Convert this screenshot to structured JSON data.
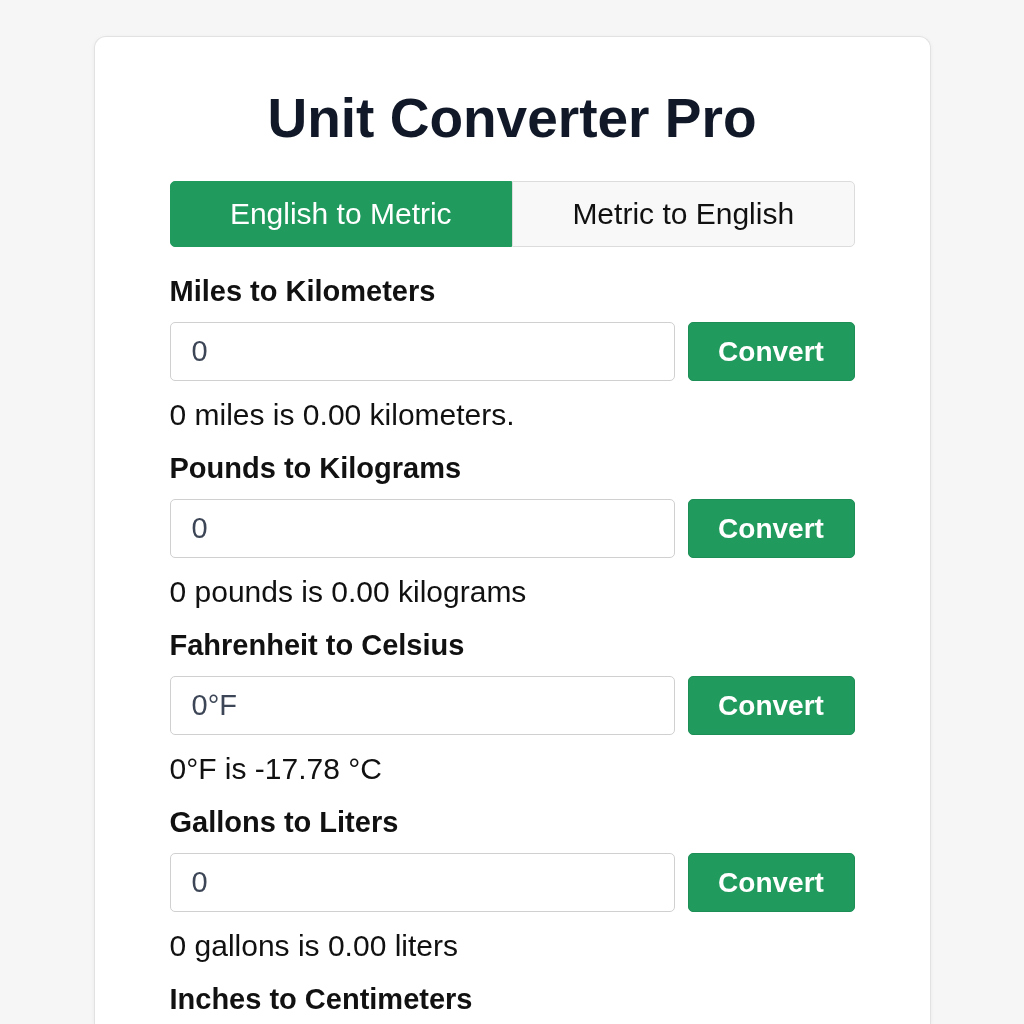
{
  "app": {
    "title": "Unit Converter Pro"
  },
  "tabs": [
    {
      "label": "English to Metric",
      "selected": true
    },
    {
      "label": "Metric to English",
      "selected": false
    }
  ],
  "converters": [
    {
      "label": "Miles to Kilometers",
      "value": "0",
      "button": "Convert",
      "result": "0 miles is 0.00 kilometers."
    },
    {
      "label": "Pounds to Kilograms",
      "value": "0",
      "button": "Convert",
      "result": "0 pounds is 0.00 kilograms"
    },
    {
      "label": "Fahrenheit to Celsius",
      "value": "0°F",
      "button": "Convert",
      "result": "0°F is -17.78 °C"
    },
    {
      "label": "Gallons to Liters",
      "value": "0",
      "button": "Convert",
      "result": "0 gallons is 0.00 liters"
    },
    {
      "label": "Inches to Centimeters"
    }
  ]
}
